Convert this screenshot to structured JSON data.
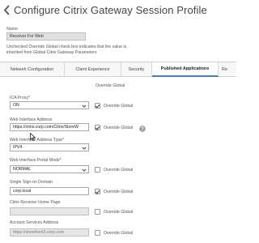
{
  "header": {
    "title": "Configure Citrix Gateway Session Profile"
  },
  "name": {
    "label": "Name",
    "value": "Receiver For Web"
  },
  "info_text": "Unchecked Override Global check box indicates that the value is inherited from Global Citrix Gateway Parameters",
  "tabs": [
    {
      "label": "Network Configuration"
    },
    {
      "label": "Client Experience"
    },
    {
      "label": "Security"
    },
    {
      "label": "Published Applications"
    },
    {
      "label": "Re"
    }
  ],
  "section": {
    "override_global_header": "Override Global"
  },
  "fields": {
    "ica_proxy": {
      "label": "ICA Proxy*",
      "value": "ON",
      "override_label": "Override Global",
      "override_checked": true
    },
    "web_interface_address": {
      "label": "Web Interface Address",
      "value": "https://citrix.corp.com/Citrix/StoreW",
      "override_label": "Override Global",
      "override_checked": true
    },
    "web_interface_address_type": {
      "label": "Web Interface Address Type*",
      "value": "IPV4"
    },
    "web_interface_portal_mode": {
      "label": "Web Interface Portal Mode*",
      "value": "NORMAL",
      "override_label": "Override Global",
      "override_checked": false
    },
    "single_sign_on_domain": {
      "label": "Single Sign-on Domain",
      "value": "corp.local",
      "override_label": "Override Global",
      "override_checked": true
    },
    "citrix_receiver_home_page": {
      "label": "Citrix Receiver Home Page",
      "value": "",
      "override_label": "Override Global",
      "override_checked": false
    },
    "account_services_address": {
      "label": "Account Services Address",
      "value": "https://storefront2.corp.com",
      "override_label": "Override Global",
      "override_checked": false
    }
  },
  "icons": {
    "back": "back-arrow-icon",
    "help": "help-icon",
    "caret": "chevron-down-icon",
    "cursor": "mouse-cursor-icon"
  },
  "colors": {
    "active_tab_border": "#4a7bb5",
    "disabled_field": "#e6e6e6",
    "help_icon": "#9a9a9a"
  }
}
